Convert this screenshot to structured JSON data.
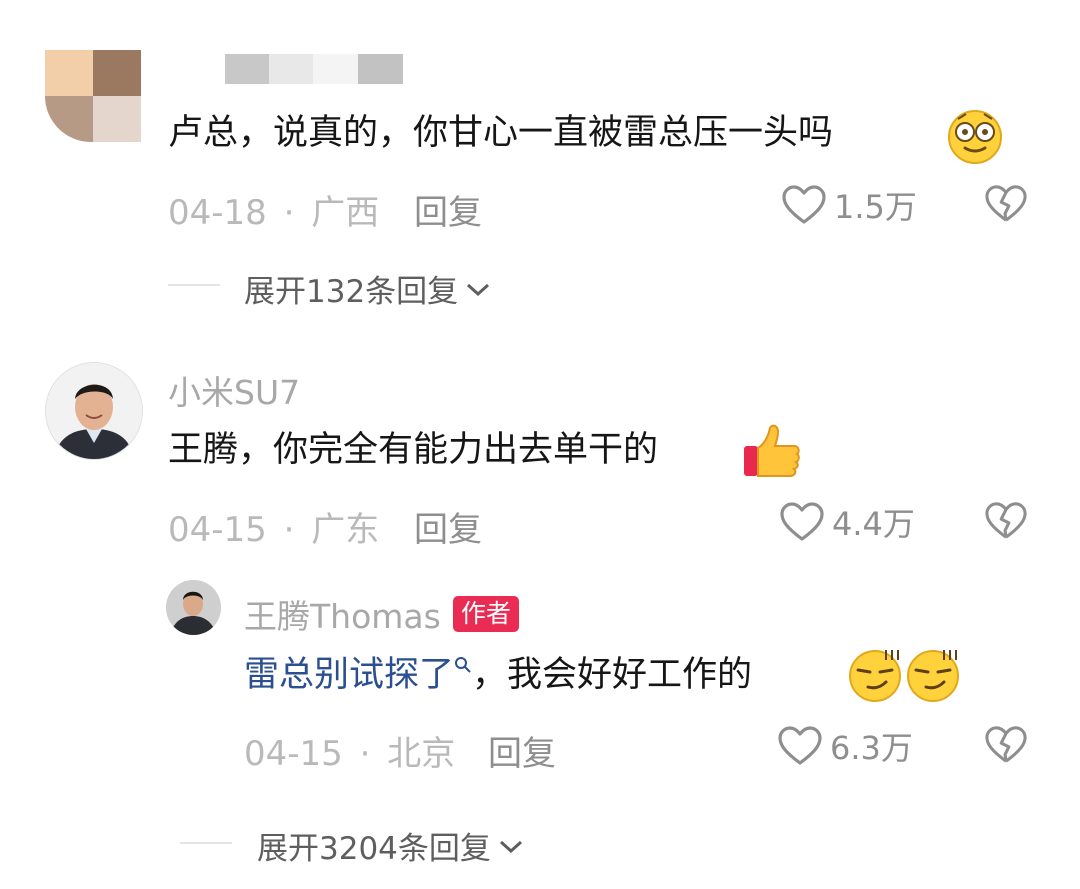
{
  "comments": [
    {
      "username": "",
      "text": "卢总，说真的，你甘心一直被雷总压一头吗",
      "date": "04-18",
      "location": "广西",
      "reply_label": "回复",
      "likes": "1.5万",
      "emoji": "dazed-face-emoji"
    },
    {
      "username": "小米SU7",
      "text": "王腾，你完全有能力出去单干的",
      "date": "04-15",
      "location": "广东",
      "reply_label": "回复",
      "likes": "4.4万",
      "emoji": "thumbs-up-emoji"
    }
  ],
  "reply": {
    "username": "王腾Thomas",
    "badge": "作者",
    "text_link": "雷总别试探了",
    "text_rest": "，我会好好工作的",
    "date": "04-15",
    "location": "北京",
    "reply_label": "回复",
    "likes": "6.3万",
    "emoji": "smirk-face-emoji"
  },
  "expand_1": "展开132条回复",
  "expand_2": "展开3204条回复",
  "separator": "·",
  "colors": {
    "badge": "#ea2c55",
    "link": "#2b4f8f"
  }
}
